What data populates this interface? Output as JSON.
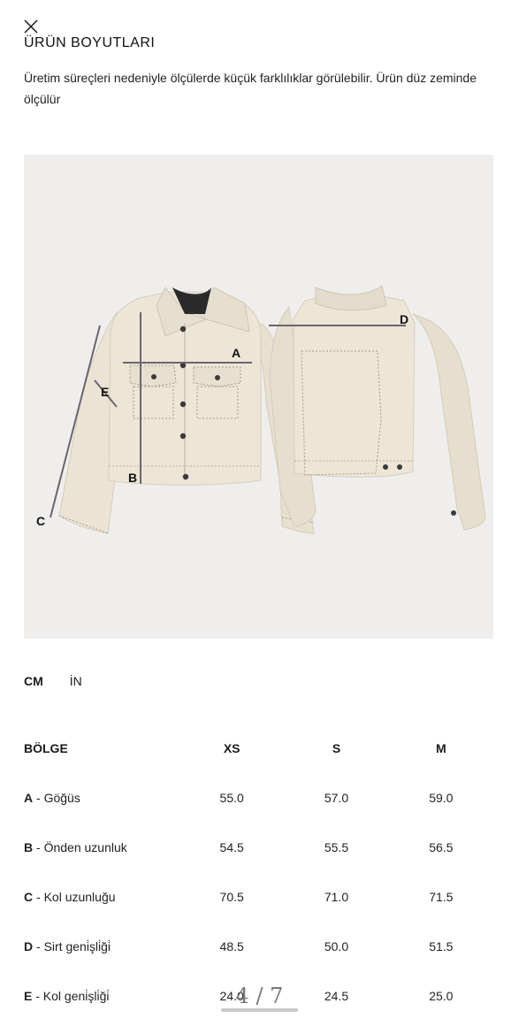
{
  "header": {
    "close_icon": "close-icon",
    "title": "ÜRÜN BOYUTLARI",
    "description": "Üretim süreçleri nedeniyle ölçülerde küçük farklılıklar görülebilir. Ürün düz zeminde ölçülür"
  },
  "figure": {
    "labels": {
      "a": "A",
      "b": "B",
      "c": "C",
      "d": "D",
      "e": "E"
    }
  },
  "units": {
    "cm": "CM",
    "in": "İN",
    "active": "CM"
  },
  "table": {
    "headers": [
      "BÖLGE",
      "XS",
      "S",
      "M"
    ],
    "rows": [
      {
        "code": "A",
        "name": " - Göğüs",
        "values": [
          "55.0",
          "57.0",
          "59.0"
        ]
      },
      {
        "code": "B",
        "name": " - Önden uzunluk",
        "values": [
          "54.5",
          "55.5",
          "56.5"
        ]
      },
      {
        "code": "C",
        "name": " - Kol uzunluğu",
        "values": [
          "70.5",
          "71.0",
          "71.5"
        ]
      },
      {
        "code": "D",
        "name": " - Sirt geni̇şli̇ği̇",
        "values": [
          "48.5",
          "50.0",
          "51.5"
        ]
      },
      {
        "code": "E",
        "name": " - Kol geni̇şli̇ği̇",
        "values": [
          "24.0",
          "24.5",
          "25.0"
        ]
      }
    ]
  },
  "pagination": {
    "text": "4 / 7"
  },
  "colors": {
    "jacket": "#ece5d6",
    "figure_bg": "#efeeec",
    "stitch": "#7a7266"
  }
}
